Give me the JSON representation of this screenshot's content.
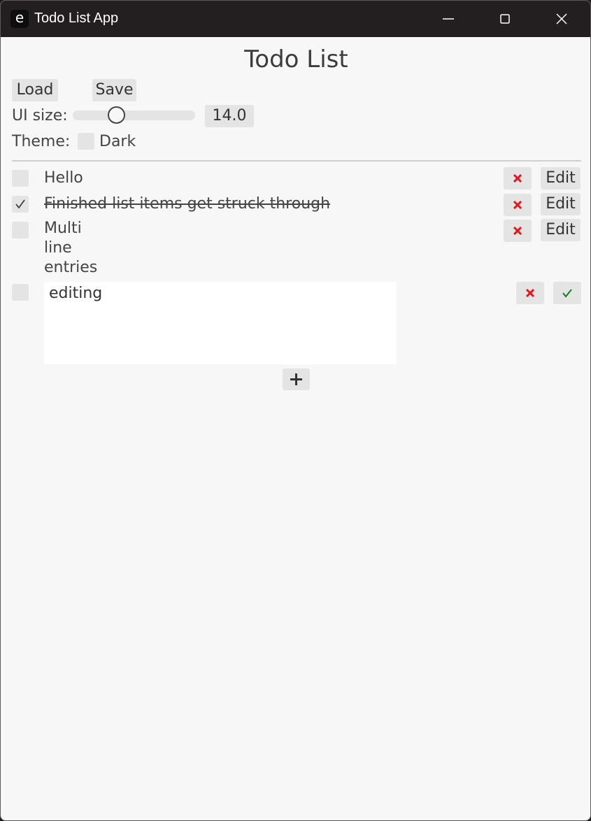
{
  "window": {
    "title": "Todo List App",
    "app_icon_glyph": "e",
    "controls": [
      "minimize-icon",
      "maximize-icon",
      "close-icon"
    ]
  },
  "heading": "Todo List",
  "toolbar": {
    "load_label": "Load",
    "save_label": "Save"
  },
  "ui_size": {
    "label": "UI size:",
    "value": "14.0",
    "slider_fraction": 0.33
  },
  "theme": {
    "label": "Theme:",
    "dark_label": "Dark",
    "dark_checked": false
  },
  "items": [
    {
      "text": "Hello",
      "done": false,
      "edit_label": "Edit"
    },
    {
      "text": "Finished list items get struck through",
      "done": true,
      "edit_label": "Edit"
    },
    {
      "text": "Multi\nline\nentries",
      "done": false,
      "edit_label": "Edit"
    },
    {
      "text": "editing",
      "done": false,
      "editing": true
    }
  ],
  "icons": {
    "delete": "cross-icon",
    "confirm": "checkmark-icon",
    "add": "plus-icon"
  },
  "colors": {
    "delete_icon": "#e8141c",
    "confirm_icon": "#1a7a1a",
    "titlebar": "#231f20"
  }
}
